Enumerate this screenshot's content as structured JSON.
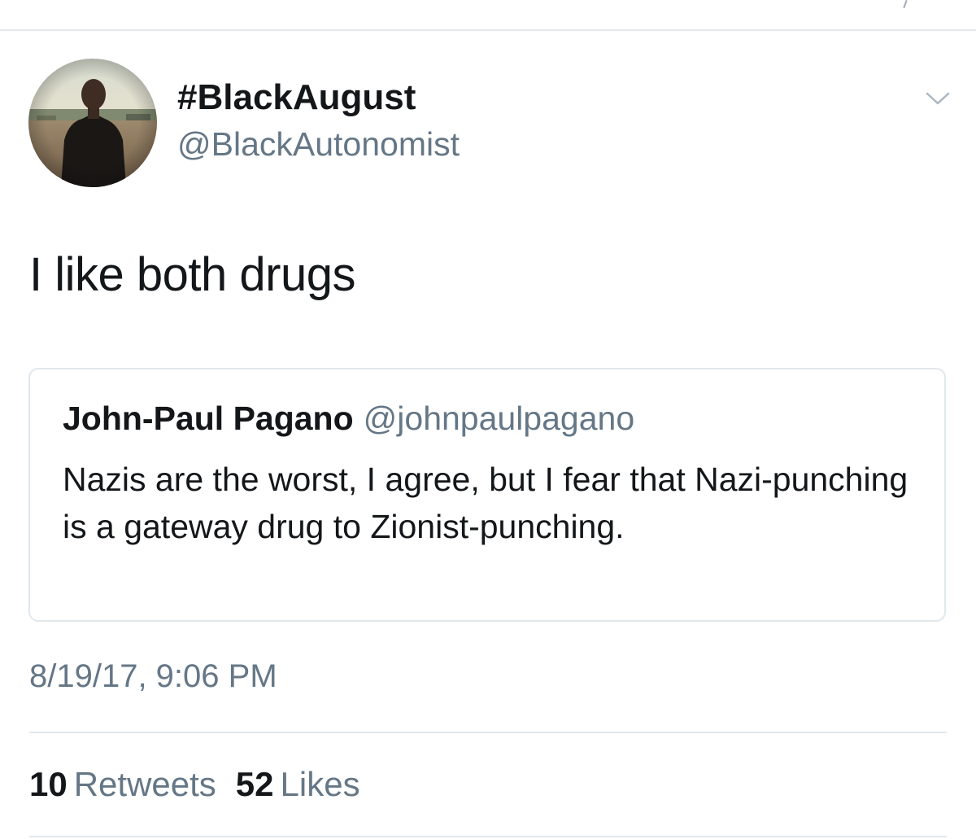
{
  "tweet": {
    "author": {
      "display_name": "#BlackAugust",
      "handle": "@BlackAutonomist",
      "avatar": "avatar-photo"
    },
    "menu_icon": "chevron-down-icon",
    "text": "I like both drugs",
    "quoted_tweet": {
      "author_name": "John-Paul Pagano",
      "author_handle": "@johnpaulpagano",
      "text": "Nazis are the worst, I agree, but I fear that Nazi-punching is a gateway drug to Zionist-punching."
    },
    "timestamp": "8/19/17, 9:06 PM",
    "stats": {
      "retweets_count": "10",
      "retweets_label": "Retweets",
      "likes_count": "52",
      "likes_label": "Likes"
    }
  },
  "colors": {
    "text_primary": "#14171a",
    "text_secondary": "#657786",
    "border": "#e1e8ed"
  }
}
